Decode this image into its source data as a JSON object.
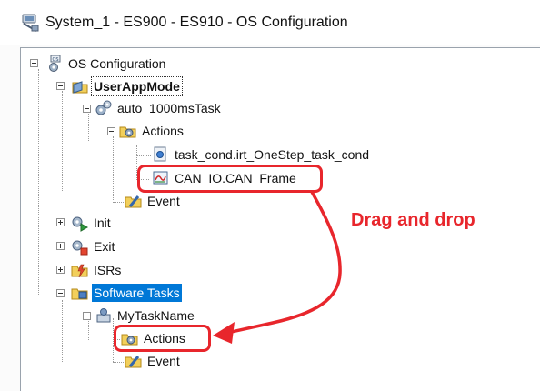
{
  "window": {
    "title": "System_1 - ES900 - ES910 - OS Configuration",
    "app_icon": "network-plug-icon"
  },
  "tree": {
    "root": "OS Configuration",
    "user_app_mode": "UserAppMode",
    "task": "auto_1000msTask",
    "actions": "Actions",
    "action_items": [
      "task_cond.irt_OneStep_task_cond",
      "CAN_IO.CAN_Frame"
    ],
    "event": "Event",
    "init": "Init",
    "exit": "Exit",
    "isrs": "ISRs",
    "software_tasks": "Software Tasks",
    "my_task": "MyTaskName",
    "my_task_actions": "Actions",
    "my_task_event": "Event"
  },
  "annotation": {
    "text": "Drag and drop"
  },
  "colors": {
    "annotation": "#e8262c",
    "selection": "#0078d7"
  }
}
